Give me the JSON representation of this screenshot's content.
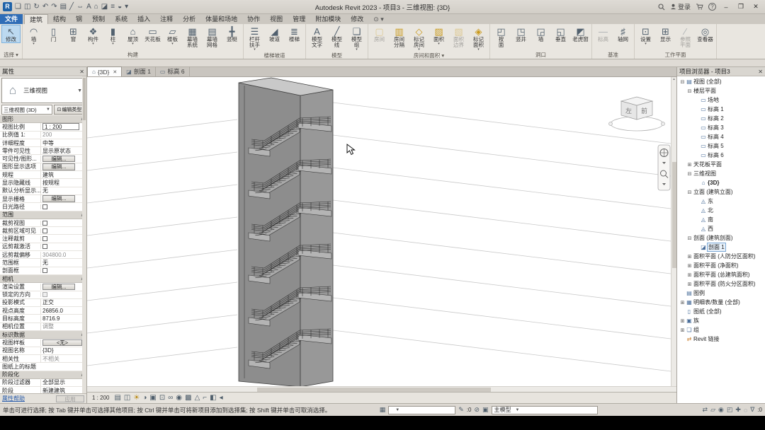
{
  "colors": {
    "titlebar_bg": "#d6d2cb",
    "ribbon_bg": "#e9e6e0",
    "file_tab_blue": "#2f6db7",
    "selection_blue": "#bcd9f0",
    "canvas_bg": "#ffffff",
    "model_gray": "#8d8d8d",
    "link_blue": "#2a5caa",
    "status_bg": "#dcd8d2"
  },
  "title_bar": {
    "qat": [
      "revit-app-icon",
      "open-icon",
      "save-icon",
      "sync-icon",
      "undo-icon",
      "redo-icon",
      "print-icon",
      "measure-icon",
      "dimension-icon",
      "text-icon",
      "default-3d-view-icon",
      "section-icon",
      "thin-lines-icon",
      "visibility-icon",
      "customize-qat-icon"
    ],
    "title": "Autodesk Revit 2023 - 项目3 - 三维视图: {3D}",
    "signin_label": "登录",
    "help_label": "?"
  },
  "menu_tabs": [
    {
      "label": "文件",
      "name": "file",
      "file": true
    },
    {
      "label": "建筑",
      "name": "architecture",
      "active": true
    },
    {
      "label": "结构",
      "name": "structure"
    },
    {
      "label": "钢",
      "name": "steel"
    },
    {
      "label": "预制",
      "name": "precast"
    },
    {
      "label": "系统",
      "name": "systems"
    },
    {
      "label": "插入",
      "name": "insert"
    },
    {
      "label": "注释",
      "name": "annotate"
    },
    {
      "label": "分析",
      "name": "analyze"
    },
    {
      "label": "体量和场地",
      "name": "massing-site"
    },
    {
      "label": "协作",
      "name": "collaborate"
    },
    {
      "label": "视图",
      "name": "view"
    },
    {
      "label": "管理",
      "name": "manage"
    },
    {
      "label": "附加模块",
      "name": "addins"
    },
    {
      "label": "修改",
      "name": "modify"
    }
  ],
  "ribbon": {
    "panels": [
      {
        "label": "选择",
        "name": "select-panel",
        "arrow": true,
        "buttons": [
          {
            "n": "modify-button",
            "l": "修改",
            "ic": "modify-arrow-icon",
            "sel": true
          }
        ]
      },
      {
        "label": "构建",
        "name": "build-panel",
        "buttons": [
          {
            "n": "wall-button",
            "l": "墙",
            "ic": "wall-icon",
            "ar": true
          },
          {
            "n": "door-button",
            "l": "门",
            "ic": "door-icon"
          },
          {
            "n": "window-button",
            "l": "窗",
            "ic": "window-icon"
          },
          {
            "n": "component-button",
            "l": "构件",
            "ic": "component-icon",
            "ar": true
          },
          {
            "n": "column-button",
            "l": "柱",
            "ic": "column-icon",
            "ar": true
          },
          {
            "n": "roof-button",
            "l": "屋顶",
            "ic": "roof-icon",
            "ar": true
          },
          {
            "n": "ceiling-button",
            "l": "天花板",
            "ic": "ceiling-icon"
          },
          {
            "n": "floor-button",
            "l": "楼板",
            "ic": "floor-icon",
            "ar": true
          },
          {
            "n": "curtain-system-button",
            "l": "幕墙\n系统",
            "ic": "curtain-system-icon"
          },
          {
            "n": "curtain-grid-button",
            "l": "幕墙\n网格",
            "ic": "curtain-grid-icon"
          },
          {
            "n": "mullion-button",
            "l": "竖梃",
            "ic": "mullion-icon"
          }
        ]
      },
      {
        "label": "楼梯坡道",
        "name": "circulation-panel",
        "buttons": [
          {
            "n": "railing-button",
            "l": "栏杆\n扶手",
            "ic": "railing-icon",
            "ar": true
          },
          {
            "n": "ramp-button",
            "l": "坡道",
            "ic": "ramp-icon"
          },
          {
            "n": "stair-button",
            "l": "楼梯",
            "ic": "stair-icon"
          }
        ]
      },
      {
        "label": "模型",
        "name": "model-panel",
        "buttons": [
          {
            "n": "model-text-button",
            "l": "模型\n文字",
            "ic": "model-text-icon"
          },
          {
            "n": "model-line-button",
            "l": "模型\n线",
            "ic": "model-line-icon"
          },
          {
            "n": "model-group-button",
            "l": "模型\n组",
            "ic": "model-group-icon",
            "ar": true
          }
        ]
      },
      {
        "label": "房间和面积",
        "name": "room-area-panel",
        "arrow": true,
        "buttons": [
          {
            "n": "room-button",
            "l": "房间",
            "ic": "room-icon",
            "dis": true
          },
          {
            "n": "room-separator-button",
            "l": "房间\n分隔",
            "ic": "room-separator-icon"
          },
          {
            "n": "tag-room-button",
            "l": "标记\n房间",
            "ic": "tag-room-icon",
            "ar": true
          },
          {
            "n": "area-button",
            "l": "面积",
            "ic": "area-icon",
            "ar": true
          },
          {
            "n": "area-boundary-button",
            "l": "面积\n边界",
            "ic": "area-boundary-icon",
            "dis": true
          },
          {
            "n": "tag-area-button",
            "l": "标记\n面积",
            "ic": "tag-area-icon",
            "ar": true
          }
        ]
      },
      {
        "label": "洞口",
        "name": "opening-panel",
        "buttons": [
          {
            "n": "opening-by-face-button",
            "l": "按\n面",
            "ic": "opening-by-face-icon"
          },
          {
            "n": "shaft-button",
            "l": "竖井",
            "ic": "shaft-icon"
          },
          {
            "n": "wall-opening-button",
            "l": "墙",
            "ic": "wall-opening-icon"
          },
          {
            "n": "vertical-opening-button",
            "l": "垂直",
            "ic": "vertical-opening-icon"
          },
          {
            "n": "dormer-button",
            "l": "老虎窗",
            "ic": "dormer-icon"
          }
        ]
      },
      {
        "label": "基准",
        "name": "datum-panel",
        "buttons": [
          {
            "n": "level-button",
            "l": "标高",
            "ic": "level-icon",
            "dis": true
          },
          {
            "n": "grid-button",
            "l": "轴网",
            "ic": "grid-icon"
          }
        ]
      },
      {
        "label": "工作平面",
        "name": "workplane-panel",
        "buttons": [
          {
            "n": "set-workplane-button",
            "l": "设置",
            "ic": "set-workplane-icon",
            "ar": true
          },
          {
            "n": "show-workplane-button",
            "l": "显示",
            "ic": "show-workplane-icon"
          },
          {
            "n": "ref-plane-button",
            "l": "参照\n平面",
            "ic": "ref-plane-icon",
            "dis": true
          },
          {
            "n": "viewer-button",
            "l": "查看器",
            "ic": "viewer-icon"
          }
        ]
      }
    ]
  },
  "view_tabs": [
    {
      "label": "{3D}",
      "name": "view-tab-3d",
      "icon": "three-d-view-icon",
      "active": true,
      "close": true
    },
    {
      "label": "剖面 1",
      "name": "view-tab-section-1",
      "icon": "section-view-icon"
    },
    {
      "label": "标高 6",
      "name": "view-tab-level-6",
      "icon": "plan-view-icon"
    }
  ],
  "properties": {
    "header": "属性",
    "type_label": "三维视图",
    "instance_value": "三维视图 (3D)",
    "edit_type_label": "编辑类型",
    "sections": [
      {
        "title": "图形",
        "rows": [
          {
            "l": "视图比例",
            "v": "1 : 200",
            "t": "input"
          },
          {
            "l": "比例值 1:",
            "v": "200",
            "t": "dis"
          },
          {
            "l": "详细程度",
            "v": "中等",
            "t": "text"
          },
          {
            "l": "零件可见性",
            "v": "显示原状态",
            "t": "text"
          },
          {
            "l": "可见性/图形...",
            "v": "编辑...",
            "t": "btn"
          },
          {
            "l": "图形显示选项",
            "v": "编辑...",
            "t": "btn"
          },
          {
            "l": "规程",
            "v": "建筑",
            "t": "text"
          },
          {
            "l": "显示隐藏线",
            "v": "按规程",
            "t": "text"
          },
          {
            "l": "默认分析显示...",
            "v": "无",
            "t": "text"
          },
          {
            "l": "显示栅格",
            "v": "编辑...",
            "t": "btn"
          },
          {
            "l": "日光路径",
            "v": "",
            "t": "chk"
          }
        ]
      },
      {
        "title": "范围",
        "rows": [
          {
            "l": "裁剪视图",
            "v": "",
            "t": "chk"
          },
          {
            "l": "裁剪区域可见",
            "v": "",
            "t": "chk"
          },
          {
            "l": "注释裁剪",
            "v": "",
            "t": "chk"
          },
          {
            "l": "远剪裁激活",
            "v": "",
            "t": "chk"
          },
          {
            "l": "远剪裁偏移",
            "v": "304800.0",
            "t": "dis"
          },
          {
            "l": "范围框",
            "v": "无",
            "t": "text"
          },
          {
            "l": "剖面框",
            "v": "",
            "t": "chk"
          }
        ]
      },
      {
        "title": "相机",
        "rows": [
          {
            "l": "渲染设置",
            "v": "编辑...",
            "t": "btn"
          },
          {
            "l": "锁定的方向",
            "v": "",
            "t": "chkdis"
          },
          {
            "l": "投影模式",
            "v": "正交",
            "t": "text"
          },
          {
            "l": "视点高度",
            "v": "26856.0",
            "t": "text"
          },
          {
            "l": "目标高度",
            "v": "8716.9",
            "t": "text"
          },
          {
            "l": "相机位置",
            "v": "调整",
            "t": "dis"
          }
        ]
      },
      {
        "title": "标识数据",
        "rows": [
          {
            "l": "视图样板",
            "v": "<无>",
            "t": "tpl"
          },
          {
            "l": "视图名称",
            "v": "{3D}",
            "t": "text"
          },
          {
            "l": "相关性",
            "v": "不相关",
            "t": "dis"
          },
          {
            "l": "图纸上的标题",
            "v": "",
            "t": "text"
          }
        ]
      },
      {
        "title": "阶段化",
        "rows": [
          {
            "l": "阶段过滤器",
            "v": "全部显示",
            "t": "text"
          },
          {
            "l": "阶段",
            "v": "新建建筑",
            "t": "text"
          }
        ]
      }
    ],
    "help_label": "属性帮助",
    "apply_label": "应用"
  },
  "project_browser": {
    "header": "项目浏览器 - 项目3",
    "tree": [
      {
        "l": "视图 (全部)",
        "lv": 0,
        "ex": "minus",
        "ic": "views-icon",
        "nm": "node-views-all"
      },
      {
        "l": "楼层平面",
        "lv": 1,
        "ex": "minus",
        "nm": "node-floor-plans"
      },
      {
        "l": "场地",
        "lv": 2,
        "ic": "plan-view-icon",
        "nm": "node-site"
      },
      {
        "l": "标高 1",
        "lv": 2,
        "ic": "plan-view-icon",
        "nm": "node-level-1"
      },
      {
        "l": "标高 2",
        "lv": 2,
        "ic": "plan-view-icon",
        "nm": "node-level-2"
      },
      {
        "l": "标高 3",
        "lv": 2,
        "ic": "plan-view-icon",
        "nm": "node-level-3"
      },
      {
        "l": "标高 4",
        "lv": 2,
        "ic": "plan-view-icon",
        "nm": "node-level-4"
      },
      {
        "l": "标高 5",
        "lv": 2,
        "ic": "plan-view-icon",
        "nm": "node-level-5"
      },
      {
        "l": "标高 6",
        "lv": 2,
        "ic": "plan-view-icon",
        "nm": "node-level-6"
      },
      {
        "l": "天花板平面",
        "lv": 1,
        "ex": "plus",
        "nm": "node-ceiling-plans"
      },
      {
        "l": "三维视图",
        "lv": 1,
        "ex": "minus",
        "nm": "node-3d-views"
      },
      {
        "l": "{3D}",
        "lv": 2,
        "ic": "three-d-view-icon",
        "bold": true,
        "nm": "node-3d"
      },
      {
        "l": "立面 (建筑立面)",
        "lv": 1,
        "ex": "minus",
        "nm": "node-elevations"
      },
      {
        "l": "东",
        "lv": 2,
        "ic": "elevation-icon",
        "nm": "node-east"
      },
      {
        "l": "北",
        "lv": 2,
        "ic": "elevation-icon",
        "nm": "node-north"
      },
      {
        "l": "南",
        "lv": 2,
        "ic": "elevation-icon",
        "nm": "node-south"
      },
      {
        "l": "西",
        "lv": 2,
        "ic": "elevation-icon",
        "nm": "node-west"
      },
      {
        "l": "剖面 (建筑剖面)",
        "lv": 1,
        "ex": "minus",
        "nm": "node-sections"
      },
      {
        "l": "剖面 1",
        "lv": 2,
        "ic": "section-view-icon",
        "sel": true,
        "nm": "node-section-1"
      },
      {
        "l": "面积平面 (人防分区面积)",
        "lv": 1,
        "ex": "plus",
        "nm": "node-area-civil-defense"
      },
      {
        "l": "面积平面 (净面积)",
        "lv": 1,
        "ex": "plus",
        "nm": "node-area-net"
      },
      {
        "l": "面积平面 (总建筑面积)",
        "lv": 1,
        "ex": "plus",
        "nm": "node-area-gross"
      },
      {
        "l": "面积平面 (防火分区面积)",
        "lv": 1,
        "ex": "plus",
        "nm": "node-area-fire"
      },
      {
        "l": "图例",
        "lv": 0,
        "ic": "legend-icon",
        "nm": "node-legends"
      },
      {
        "l": "明细表/数量 (全部)",
        "lv": 0,
        "ex": "plus",
        "ic": "schedule-icon",
        "nm": "node-schedules"
      },
      {
        "l": "图纸 (全部)",
        "lv": 0,
        "ic": "sheet-icon",
        "nm": "node-sheets"
      },
      {
        "l": "族",
        "lv": 0,
        "ex": "plus",
        "ic": "family-icon",
        "nm": "node-families"
      },
      {
        "l": "组",
        "lv": 0,
        "ex": "plus",
        "ic": "group-icon",
        "nm": "node-groups"
      },
      {
        "l": "Revit 链接",
        "lv": 0,
        "ic": "revit-link-icon",
        "nm": "node-revit-links"
      }
    ]
  },
  "canvas": {
    "viewcube": {
      "left": "左",
      "front": "前"
    }
  },
  "view_control_bar": {
    "scale": "1 : 200",
    "icons": [
      "detail-level-icon",
      "visual-style-icon",
      "sun-path-icon",
      "shadows-icon",
      "crop-view-icon",
      "show-crop-icon",
      "temporary-hide-icon",
      "reveal-hidden-icon",
      "temporary-view-properties-icon",
      "show-analytical-icon",
      "reveal-constraints-icon",
      "worksharing-display-icon",
      "collapse-icon"
    ]
  },
  "status_bar": {
    "hint": "单击可进行选择; 按 Tab 键并单击可选择其他项目; 按 Ctrl 键并单击可将新项目添加到选择集; 按 Shift 键并单击可取消选择。",
    "workset_value": "",
    "requests_count": ":0",
    "design_option_value": "主模型",
    "filter_count": ":0",
    "left_icons": [
      "worksets-icon",
      "editing-requests-icon",
      "editable-only-icon",
      "design-options-icon"
    ],
    "right_icons": [
      "select-links-icon",
      "select-underlay-icon",
      "select-pinned-icon",
      "select-by-face-icon",
      "drag-on-selection-icon",
      "background-processes-icon"
    ]
  }
}
